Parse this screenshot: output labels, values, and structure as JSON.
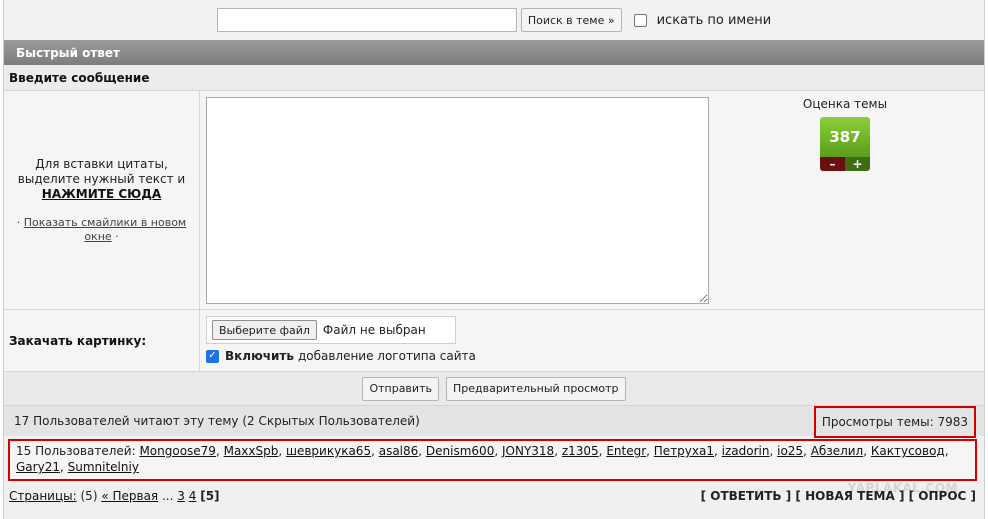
{
  "search": {
    "placeholder": "",
    "button_label": "Поиск в теме »",
    "by_name_label": "искать по имени"
  },
  "quick_reply": {
    "header": "Быстрый ответ",
    "enter_message": "Введите сообщение",
    "quote_hint": "Для вставки цитаты, выделите нужный текст и",
    "quote_link": "НАЖМИТЕ СЮДА",
    "smiley_prefix": "·",
    "smiley_link": "Показать смайлики в новом окне",
    "smiley_suffix": "·"
  },
  "rating": {
    "label": "Оценка темы",
    "value": "387",
    "minus": "–",
    "plus": "+"
  },
  "upload": {
    "label": "Закачать картинку:",
    "file_button": "Выберите файл",
    "file_status": "Файл не выбран",
    "logo_bold": "Включить",
    "logo_rest": "добавление логотипа сайта"
  },
  "buttons": {
    "send": "Отправить",
    "preview": "Предварительный просмотр"
  },
  "viewers": {
    "summary": "17 Пользователей читают эту тему (2 Скрытых Пользователей)",
    "views": "Просмотры темы: 7983",
    "users_prefix": "15 Пользователей:",
    "users": [
      "Mongoose79",
      "MaxxSpb",
      "шеврикука65",
      "asal86",
      "Denism600",
      "JONY318",
      "z1305",
      "Entegr",
      "Петруха1",
      "izadorin",
      "io25",
      "Абзелил",
      "Кактусовод",
      "Gary21",
      "Sumnitelniy"
    ]
  },
  "pagination": {
    "label": "Страницы:",
    "count": "(5)",
    "first": "« Первая",
    "ellipsis": "...",
    "pages": [
      "3",
      "4"
    ],
    "current": "[5]"
  },
  "actions": {
    "reply": "[ ОТВЕТИТЬ ]",
    "new_topic": "[ НОВАЯ ТЕМА ]",
    "poll": "[ ОПРОС ]"
  },
  "watermark": "YAPLAKAL.COM"
}
